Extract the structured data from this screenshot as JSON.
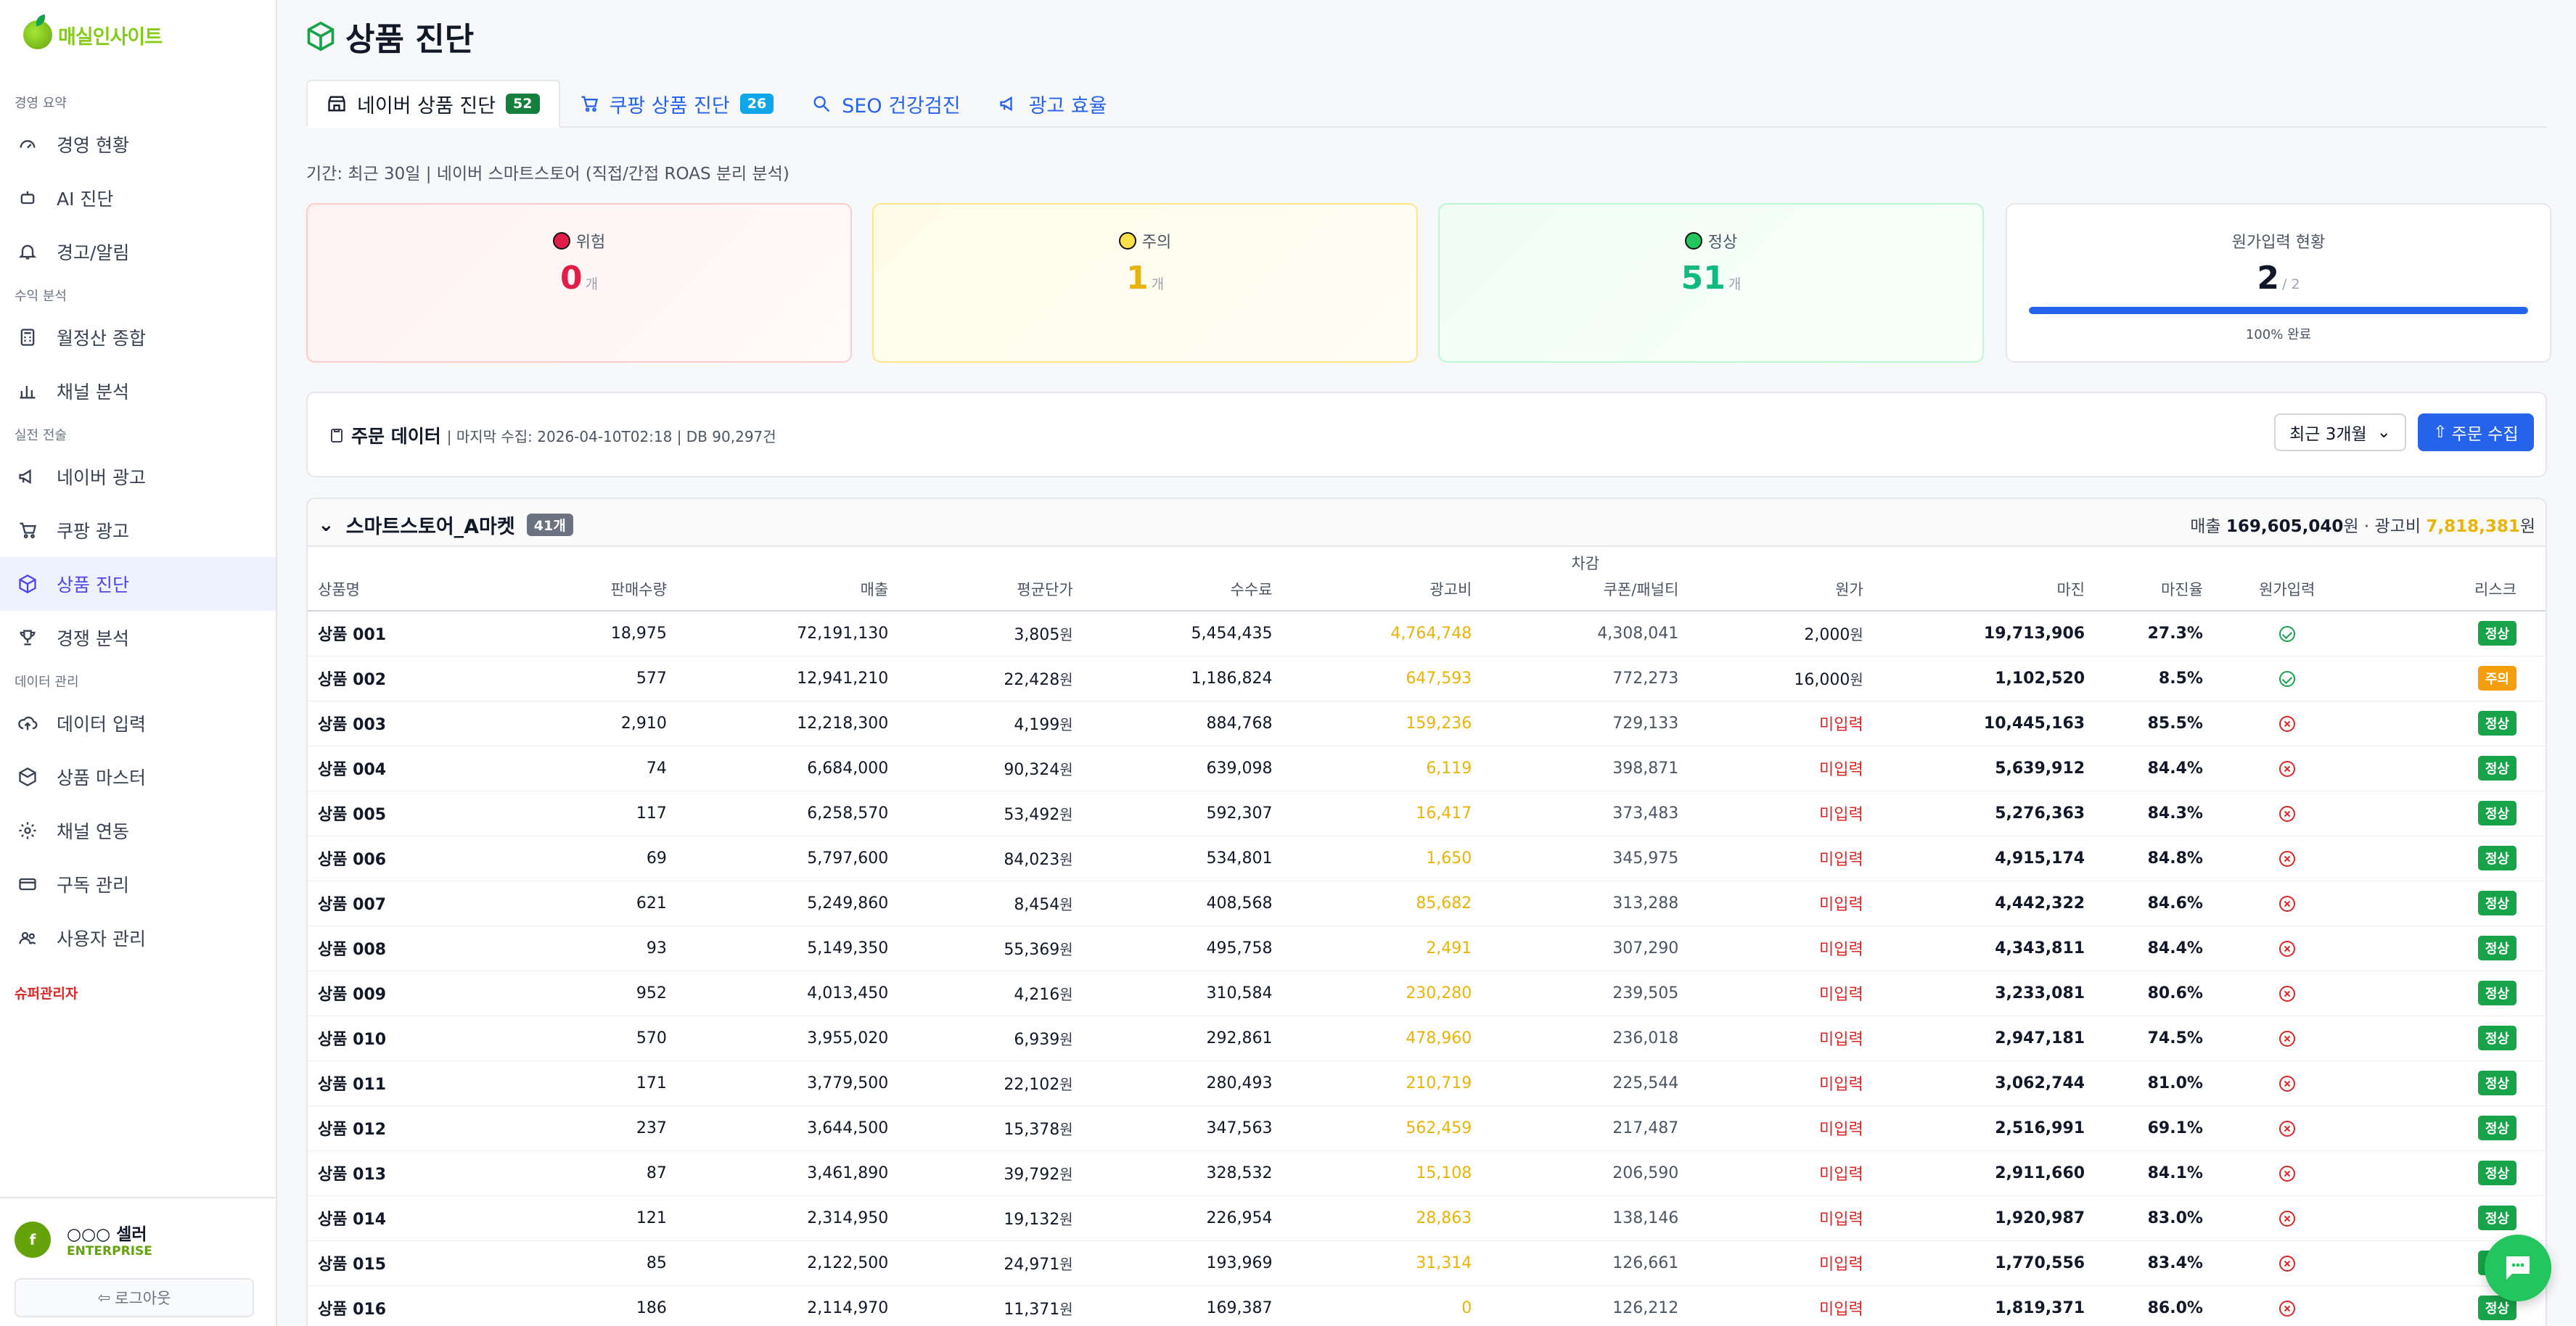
{
  "brand": {
    "name": "매실인사이트"
  },
  "sidebar": {
    "sections": [
      {
        "title": "경영 요약",
        "items": [
          {
            "label": "경영 현황",
            "icon": "gauge-icon"
          },
          {
            "label": "AI 진단",
            "icon": "robot-icon"
          },
          {
            "label": "경고/알림",
            "icon": "bell-icon"
          }
        ]
      },
      {
        "title": "수익 분석",
        "items": [
          {
            "label": "월정산 종합",
            "icon": "calculator-icon"
          },
          {
            "label": "채널 분석",
            "icon": "bar-chart-icon"
          }
        ]
      },
      {
        "title": "실전 전술",
        "items": [
          {
            "label": "네이버 광고",
            "icon": "megaphone-icon"
          },
          {
            "label": "쿠팡 광고",
            "icon": "cart-icon"
          },
          {
            "label": "상품 진단",
            "icon": "box-icon",
            "active": true
          },
          {
            "label": "경쟁 분석",
            "icon": "trophy-icon"
          }
        ]
      },
      {
        "title": "데이터 관리",
        "items": [
          {
            "label": "데이터 입력",
            "icon": "upload-cloud-icon"
          },
          {
            "label": "상품 마스터",
            "icon": "package-icon"
          },
          {
            "label": "채널 연동",
            "icon": "settings-icon"
          },
          {
            "label": "구독 관리",
            "icon": "credit-card-icon"
          },
          {
            "label": "사용자 관리",
            "icon": "users-icon"
          }
        ]
      }
    ],
    "super_admin": "슈퍼관리자",
    "user": {
      "avatar_letter": "f",
      "name": "○○○ 셀러",
      "plan": "ENTERPRISE"
    },
    "logout_label": "로그아웃"
  },
  "page": {
    "title": "상품 진단",
    "tabs": [
      {
        "label": "네이버 상품 진단",
        "badge": "52",
        "active": true
      },
      {
        "label": "쿠팡 상품 진단",
        "badge": "26"
      },
      {
        "label": "SEO 건강검진"
      },
      {
        "label": "광고 효율"
      }
    ],
    "period": "기간: 최근 30일 | 네이버 스마트스토어 (직접/간접 ROAS 분리 분석)"
  },
  "cards": {
    "danger": {
      "label": "위험",
      "value": "0",
      "unit": "개"
    },
    "warn": {
      "label": "주의",
      "value": "1",
      "unit": "개"
    },
    "ok": {
      "label": "정상",
      "value": "51",
      "unit": "개"
    },
    "cost": {
      "label": "원가입력 현황",
      "value": "2",
      "total": "/ 2",
      "progress": 1.0,
      "progress_text": "100% 완료"
    }
  },
  "orders": {
    "title": "주문 데이터",
    "meta": "| 마지막 수집: 2026-04-10T02:18 | DB 90,297건",
    "range": "최근 3개월",
    "collect_label": "주문 수집"
  },
  "store": {
    "name": "스마트스토어_A마켓",
    "count": "41개",
    "sales_label": "매출",
    "sales": "169,605,040",
    "ad_label": "· 광고비",
    "ad": "7,818,381",
    "won": "원"
  },
  "table": {
    "headers": {
      "name": "상품명",
      "qty": "판매수량",
      "sales": "매출",
      "avg": "평균단가",
      "fee": "수수료",
      "ad": "광고비",
      "deduct_top": "차감",
      "deduct": "쿠폰/패널티",
      "cost": "원가",
      "margin": "마진",
      "margin_rate": "마진율",
      "cost_input": "원가입력",
      "risk": "리스크"
    },
    "won": "원",
    "rows": [
      {
        "name": "상품 001",
        "qty": "18,975",
        "sales": "72,191,130",
        "avg": "3,805",
        "fee": "5,454,435",
        "ad": "4,764,748",
        "deduct": "4,308,041",
        "cost": "2,000",
        "cost_missing": false,
        "margin": "19,713,906",
        "rate": "27.3%",
        "risk": "정상",
        "risk_level": "normal"
      },
      {
        "name": "상품 002",
        "qty": "577",
        "sales": "12,941,210",
        "avg": "22,428",
        "fee": "1,186,824",
        "ad": "647,593",
        "deduct": "772,273",
        "cost": "16,000",
        "cost_missing": false,
        "margin": "1,102,520",
        "rate": "8.5%",
        "risk": "주의",
        "risk_level": "caution"
      },
      {
        "name": "상품 003",
        "qty": "2,910",
        "sales": "12,218,300",
        "avg": "4,199",
        "fee": "884,768",
        "ad": "159,236",
        "deduct": "729,133",
        "cost": "미입력",
        "cost_missing": true,
        "margin": "10,445,163",
        "rate": "85.5%",
        "risk": "정상",
        "risk_level": "normal"
      },
      {
        "name": "상품 004",
        "qty": "74",
        "sales": "6,684,000",
        "avg": "90,324",
        "fee": "639,098",
        "ad": "6,119",
        "deduct": "398,871",
        "cost": "미입력",
        "cost_missing": true,
        "margin": "5,639,912",
        "rate": "84.4%",
        "risk": "정상",
        "risk_level": "normal"
      },
      {
        "name": "상품 005",
        "qty": "117",
        "sales": "6,258,570",
        "avg": "53,492",
        "fee": "592,307",
        "ad": "16,417",
        "deduct": "373,483",
        "cost": "미입력",
        "cost_missing": true,
        "margin": "5,276,363",
        "rate": "84.3%",
        "risk": "정상",
        "risk_level": "normal"
      },
      {
        "name": "상품 006",
        "qty": "69",
        "sales": "5,797,600",
        "avg": "84,023",
        "fee": "534,801",
        "ad": "1,650",
        "deduct": "345,975",
        "cost": "미입력",
        "cost_missing": true,
        "margin": "4,915,174",
        "rate": "84.8%",
        "risk": "정상",
        "risk_level": "normal"
      },
      {
        "name": "상품 007",
        "qty": "621",
        "sales": "5,249,860",
        "avg": "8,454",
        "fee": "408,568",
        "ad": "85,682",
        "deduct": "313,288",
        "cost": "미입력",
        "cost_missing": true,
        "margin": "4,442,322",
        "rate": "84.6%",
        "risk": "정상",
        "risk_level": "normal"
      },
      {
        "name": "상품 008",
        "qty": "93",
        "sales": "5,149,350",
        "avg": "55,369",
        "fee": "495,758",
        "ad": "2,491",
        "deduct": "307,290",
        "cost": "미입력",
        "cost_missing": true,
        "margin": "4,343,811",
        "rate": "84.4%",
        "risk": "정상",
        "risk_level": "normal"
      },
      {
        "name": "상품 009",
        "qty": "952",
        "sales": "4,013,450",
        "avg": "4,216",
        "fee": "310,584",
        "ad": "230,280",
        "deduct": "239,505",
        "cost": "미입력",
        "cost_missing": true,
        "margin": "3,233,081",
        "rate": "80.6%",
        "risk": "정상",
        "risk_level": "normal"
      },
      {
        "name": "상품 010",
        "qty": "570",
        "sales": "3,955,020",
        "avg": "6,939",
        "fee": "292,861",
        "ad": "478,960",
        "deduct": "236,018",
        "cost": "미입력",
        "cost_missing": true,
        "margin": "2,947,181",
        "rate": "74.5%",
        "risk": "정상",
        "risk_level": "normal"
      },
      {
        "name": "상품 011",
        "qty": "171",
        "sales": "3,779,500",
        "avg": "22,102",
        "fee": "280,493",
        "ad": "210,719",
        "deduct": "225,544",
        "cost": "미입력",
        "cost_missing": true,
        "margin": "3,062,744",
        "rate": "81.0%",
        "risk": "정상",
        "risk_level": "normal"
      },
      {
        "name": "상품 012",
        "qty": "237",
        "sales": "3,644,500",
        "avg": "15,378",
        "fee": "347,563",
        "ad": "562,459",
        "deduct": "217,487",
        "cost": "미입력",
        "cost_missing": true,
        "margin": "2,516,991",
        "rate": "69.1%",
        "risk": "정상",
        "risk_level": "normal"
      },
      {
        "name": "상품 013",
        "qty": "87",
        "sales": "3,461,890",
        "avg": "39,792",
        "fee": "328,532",
        "ad": "15,108",
        "deduct": "206,590",
        "cost": "미입력",
        "cost_missing": true,
        "margin": "2,911,660",
        "rate": "84.1%",
        "risk": "정상",
        "risk_level": "normal"
      },
      {
        "name": "상품 014",
        "qty": "121",
        "sales": "2,314,950",
        "avg": "19,132",
        "fee": "226,954",
        "ad": "28,863",
        "deduct": "138,146",
        "cost": "미입력",
        "cost_missing": true,
        "margin": "1,920,987",
        "rate": "83.0%",
        "risk": "정상",
        "risk_level": "normal"
      },
      {
        "name": "상품 015",
        "qty": "85",
        "sales": "2,122,500",
        "avg": "24,971",
        "fee": "193,969",
        "ad": "31,314",
        "deduct": "126,661",
        "cost": "미입력",
        "cost_missing": true,
        "margin": "1,770,556",
        "rate": "83.4%",
        "risk": "정상",
        "risk_level": "normal"
      },
      {
        "name": "상품 016",
        "qty": "186",
        "sales": "2,114,970",
        "avg": "11,371",
        "fee": "169,387",
        "ad": "0",
        "deduct": "126,212",
        "cost": "미입력",
        "cost_missing": true,
        "margin": "1,819,371",
        "rate": "86.0%",
        "risk": "정상",
        "risk_level": "normal"
      }
    ]
  },
  "colors": {
    "accent": "#2563eb",
    "brand": "#84cc16",
    "danger": "#e11d48",
    "warn": "#eab308",
    "ok": "#10b981"
  }
}
